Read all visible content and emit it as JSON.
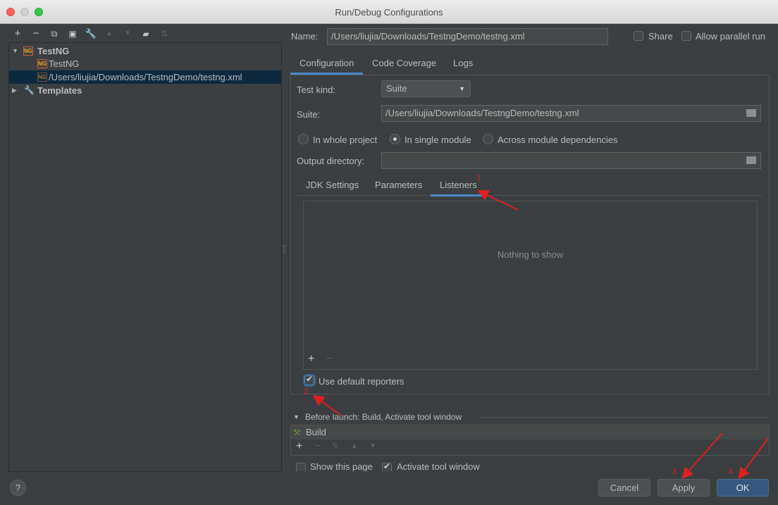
{
  "window": {
    "title": "Run/Debug Configurations"
  },
  "toolbar": {
    "icons": [
      "add-icon",
      "remove-icon",
      "copy-icon",
      "save-icon",
      "wrench-icon",
      "move-up-icon",
      "move-down-icon",
      "folder-add-icon",
      "sort-icon"
    ]
  },
  "tree": {
    "items": [
      {
        "label": "TestNG",
        "icon": "testng-icon",
        "expanded": true,
        "bold": true
      },
      {
        "label": "TestNG",
        "icon": "testng-icon"
      },
      {
        "label": "/Users/liujia/Downloads/TestngDemo/testng.xml",
        "icon": "testng-icon",
        "selected": true
      },
      {
        "label": "Templates",
        "icon": "wrench-icon",
        "expanded": false,
        "bold": true
      }
    ]
  },
  "form": {
    "name_label": "Name:",
    "name_value": "/Users/liujia/Downloads/TestngDemo/testng.xml",
    "share_label": "Share",
    "parallel_label": "Allow parallel run",
    "tabs": [
      "Configuration",
      "Code Coverage",
      "Logs"
    ],
    "test_kind_label": "Test kind:",
    "test_kind_value": "Suite",
    "suite_label": "Suite:",
    "suite_value": "/Users/liujia/Downloads/TestngDemo/testng.xml",
    "scope_options": [
      "In whole project",
      "In single module",
      "Across module dependencies"
    ],
    "scope_selected": "In single module",
    "output_label": "Output directory:",
    "output_value": "",
    "subtabs": [
      "JDK Settings",
      "Parameters",
      "Listeners"
    ],
    "subtab_selected": "Listeners",
    "empty_text": "Nothing to show",
    "use_default_reporters_label": "Use default reporters",
    "use_default_reporters_checked": true
  },
  "before_launch": {
    "header": "Before launch: Build, Activate tool window",
    "items": [
      "Build"
    ],
    "show_page_label": "Show this page",
    "activate_label": "Activate tool window"
  },
  "buttons": {
    "help": "?",
    "cancel": "Cancel",
    "apply": "Apply",
    "ok": "OK"
  },
  "annotations": [
    "1",
    "2",
    "3",
    "4"
  ],
  "colors": {
    "background": "#3c3f41",
    "accent": "#4a88c7",
    "primary_button": "#365880",
    "selection": "#0d293e",
    "annotation": "#e02020"
  }
}
